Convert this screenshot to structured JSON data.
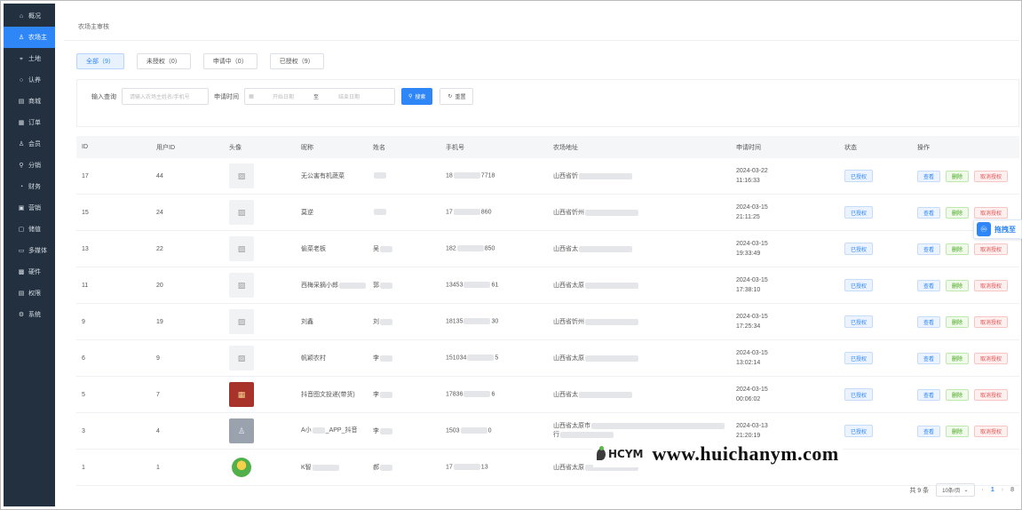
{
  "sidebar": {
    "items": [
      {
        "label": "概况",
        "icon": "home-icon",
        "glyph": "⌂"
      },
      {
        "label": "农场主",
        "icon": "user-icon",
        "glyph": "♙",
        "active": true
      },
      {
        "label": "土地",
        "icon": "land-icon",
        "glyph": "⌖"
      },
      {
        "label": "认养",
        "icon": "adopt-icon",
        "glyph": "○"
      },
      {
        "label": "商城",
        "icon": "shop-icon",
        "glyph": "▤"
      },
      {
        "label": "订单",
        "icon": "order-icon",
        "glyph": "▦"
      },
      {
        "label": "会员",
        "icon": "member-icon",
        "glyph": "♙"
      },
      {
        "label": "分销",
        "icon": "distribution-icon",
        "glyph": "⚲"
      },
      {
        "label": "财务",
        "icon": "finance-icon",
        "glyph": "◔"
      },
      {
        "label": "营销",
        "icon": "marketing-icon",
        "glyph": "▣"
      },
      {
        "label": "储值",
        "icon": "stored-value-icon",
        "glyph": "▢"
      },
      {
        "label": "多媒体",
        "icon": "media-icon",
        "glyph": "▭"
      },
      {
        "label": "硬件",
        "icon": "hardware-icon",
        "glyph": "▩"
      },
      {
        "label": "权限",
        "icon": "permission-icon",
        "glyph": "▤"
      },
      {
        "label": "系统",
        "icon": "settings-icon",
        "glyph": "⚙"
      }
    ]
  },
  "breadcrumb": "农场主审核",
  "tabs": [
    {
      "label": "全部（9）",
      "active": true
    },
    {
      "label": "未授权（0）"
    },
    {
      "label": "申请中（0）"
    },
    {
      "label": "已授权（9）"
    }
  ],
  "filter": {
    "query_label": "输入查询",
    "query_placeholder": "请输入农场主姓名/手机号",
    "time_label": "申请时间",
    "start_placeholder": "开始日期",
    "separator": "至",
    "end_placeholder": "结束日期",
    "search_label": "搜索",
    "reset_label": "重置"
  },
  "table": {
    "headers": [
      "ID",
      "用户ID",
      "头像",
      "昵称",
      "姓名",
      "手机号",
      "农场地址",
      "申请时间",
      "状态",
      "操作"
    ],
    "rows": [
      {
        "id": "17",
        "user_id": "44",
        "avatar": "placeholder",
        "nickname": "无公害有机蔬菜",
        "name": "",
        "phone": "18",
        "phone_tail": "7718",
        "address": "山西省忻",
        "date": "2024-03-22",
        "time": "11:16:33",
        "status": "已授权",
        "ops": [
          "查看",
          "删除",
          "取消授权"
        ]
      },
      {
        "id": "15",
        "user_id": "24",
        "avatar": "placeholder",
        "nickname": "莫逆",
        "name": "",
        "phone": "17",
        "phone_tail": "860",
        "address": "山西省忻州",
        "date": "2024-03-15",
        "time": "21:11:25",
        "status": "已授权",
        "ops": [
          "查看",
          "删除",
          "取消授权"
        ]
      },
      {
        "id": "13",
        "user_id": "22",
        "avatar": "placeholder",
        "nickname": "偷菜老板",
        "name": "吴",
        "phone": "182",
        "phone_tail": "850",
        "address": "山西省太",
        "date": "2024-03-15",
        "time": "19:33:49",
        "status": "已授权",
        "ops": [
          "查看",
          "删除",
          "取消授权"
        ]
      },
      {
        "id": "11",
        "user_id": "20",
        "avatar": "placeholder",
        "nickname": "西梅采摘小郎",
        "name": "郭",
        "phone": "13453",
        "phone_tail": "61",
        "address": "山西省太原",
        "date": "2024-03-15",
        "time": "17:38:10",
        "status": "已授权",
        "ops": [
          "查看",
          "删除",
          "取消授权"
        ]
      },
      {
        "id": "9",
        "user_id": "19",
        "avatar": "placeholder",
        "nickname": "刘鑫",
        "name": "刘",
        "phone": "18135",
        "phone_tail": "30",
        "address": "山西省忻州",
        "date": "2024-03-15",
        "time": "17:25:34",
        "status": "已授权",
        "ops": [
          "查看",
          "删除",
          "取消授权"
        ]
      },
      {
        "id": "6",
        "user_id": "9",
        "avatar": "placeholder",
        "nickname": "帆颖农村",
        "name": "李",
        "phone": "151034",
        "phone_tail": "5",
        "address": "山西省太原",
        "date": "2024-03-15",
        "time": "13:02:14",
        "status": "已授权",
        "ops": [
          "查看",
          "删除",
          "取消授权"
        ]
      },
      {
        "id": "5",
        "user_id": "7",
        "avatar": "red",
        "nickname": "抖音图文投递(带货)",
        "name": "李",
        "phone": "17836",
        "phone_tail": "6",
        "address": "山西省太",
        "date": "2024-03-15",
        "time": "00:06:02",
        "status": "已授权",
        "ops": [
          "查看",
          "删除",
          "取消授权"
        ]
      },
      {
        "id": "3",
        "user_id": "4",
        "avatar": "person",
        "nickname": "A小",
        "nickname_2": "_APP_抖音",
        "name": "李",
        "phone": "1503",
        "phone_tail": "0",
        "address": "山西省太原市",
        "address_2": "行",
        "date": "2024-03-13",
        "time": "21:20:19",
        "status": "已授权",
        "ops": [
          "查看",
          "删除",
          "取消授权"
        ]
      },
      {
        "id": "1",
        "user_id": "1",
        "avatar": "logo",
        "nickname": "K智",
        "name": "郝",
        "phone": "17",
        "phone_tail": "13",
        "address": "山西省太原",
        "date": "",
        "time": "",
        "status": "",
        "ops": []
      }
    ]
  },
  "pagination": {
    "total": "共 9 条",
    "page_size": "10条/页",
    "prev": "‹",
    "current": "1",
    "next": "›",
    "jump": "8"
  },
  "float_button": {
    "label": "拖拽至"
  },
  "watermark": {
    "logo_text": "HCYM",
    "url": "www.huichanym.com"
  },
  "colors": {
    "sidebar": "#22303f",
    "accent": "#2f86f6",
    "delete": "#43a31a",
    "cancel": "#e0504f"
  }
}
